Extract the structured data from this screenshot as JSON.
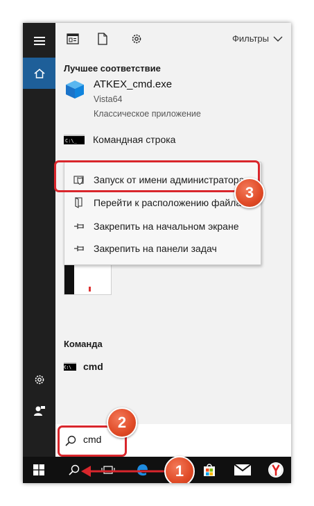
{
  "topbar": {
    "filters_label": "Фильтры",
    "icons": [
      "apps-view-icon",
      "document-icon",
      "gear-icon",
      "chevron-down-icon"
    ]
  },
  "sections": {
    "best_match": "Лучшее соответствие",
    "command": "Команда"
  },
  "best_match": {
    "title": "ATKEX_cmd.exe",
    "subtitle": "Vista64",
    "type": "Классическое приложение"
  },
  "command_prompt_label": "Командная строка",
  "context_menu": {
    "items": [
      {
        "label": "Запуск от имени администратора",
        "icon": "shield-icon"
      },
      {
        "label": "Перейти к расположению файла",
        "icon": "folder-open-icon"
      },
      {
        "label": "Закрепить на начальном экране",
        "icon": "pin-icon"
      },
      {
        "label": "Закрепить на панели задач",
        "icon": "pin-icon"
      }
    ]
  },
  "command_result": "cmd",
  "search": {
    "value": "cmd",
    "icon": "search-icon"
  },
  "taskbar": {
    "icons": [
      "windows-start-icon",
      "search-icon",
      "task-view-icon",
      "edge-icon",
      "store-icon",
      "mail-icon",
      "yandex-browser-icon"
    ]
  },
  "annotations": {
    "badge_1": "1",
    "badge_2": "2",
    "badge_3": "3"
  },
  "colors": {
    "rail_bg": "#1f1f1f",
    "home_accent": "#1e5f99",
    "annotation_red": "#d9262c",
    "badge_orange": "#e04a26",
    "taskbar_bg": "#101010"
  }
}
